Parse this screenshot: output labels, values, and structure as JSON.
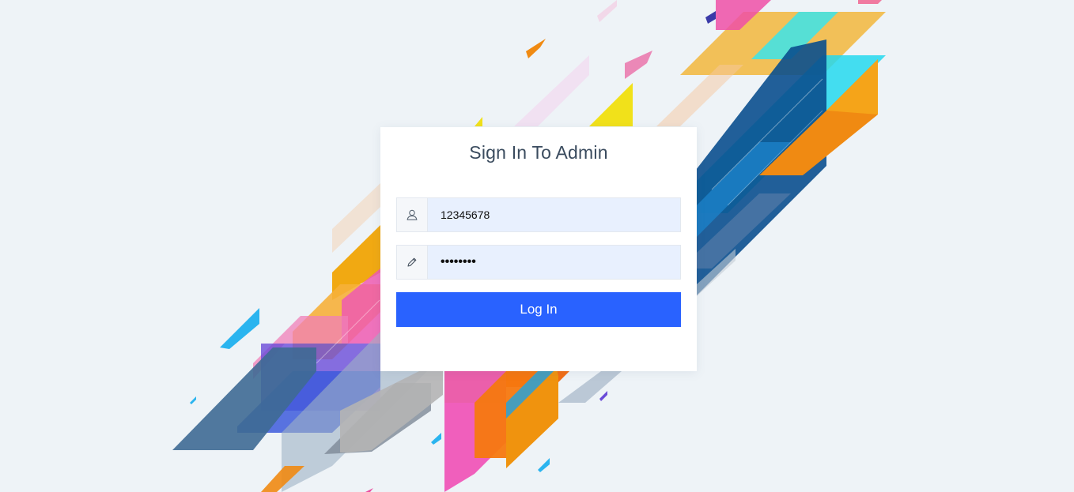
{
  "login": {
    "title": "Sign In To Admin",
    "username": {
      "icon": "user-icon",
      "value": "12345678"
    },
    "password": {
      "icon": "pencil-icon",
      "value": "••••••••"
    },
    "button_label": "Log In"
  },
  "colors": {
    "background": "#eef3f7",
    "card": "#ffffff",
    "title_text": "#3a4b5e",
    "input_fill": "#e8f0fe",
    "button": "#2962ff",
    "button_text": "#ffffff"
  }
}
